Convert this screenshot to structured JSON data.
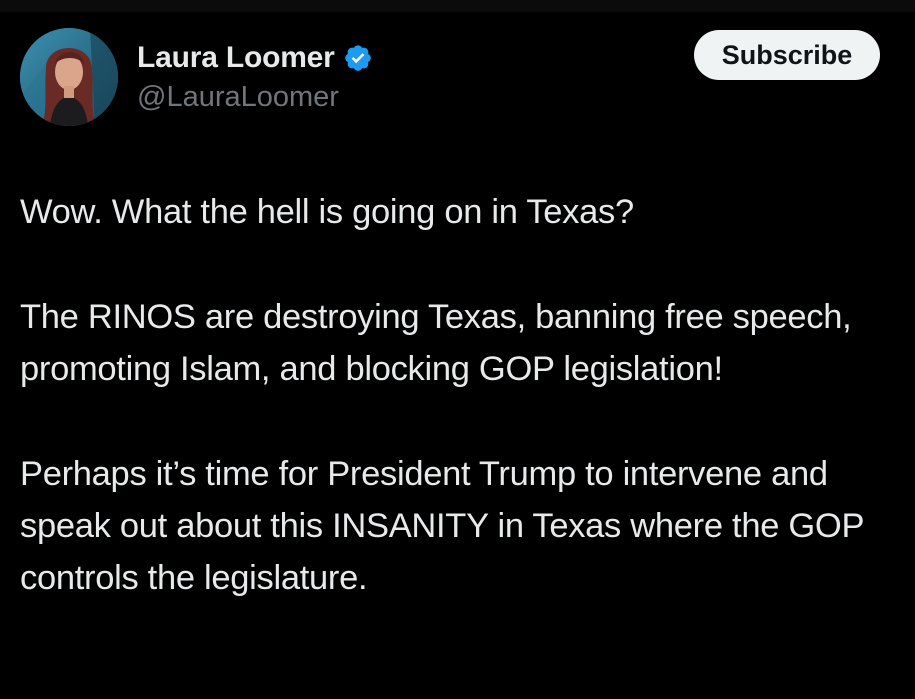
{
  "author": {
    "display_name": "Laura Loomer",
    "handle": "@LauraLoomer",
    "verified_icon": "verified-badge-icon",
    "verified_color": "#1d9bf0"
  },
  "actions": {
    "subscribe_label": "Subscribe"
  },
  "tweet": {
    "paragraphs": [
      "Wow. What the hell is going on in Texas?",
      "The RINOS are destroying Texas, banning free speech, promoting Islam, and blocking GOP legislation!",
      "Perhaps it’s time for President Trump to intervene and speak out about this INSANITY in Texas where the GOP controls the legislature."
    ]
  },
  "colors": {
    "background": "#000000",
    "text_primary": "#e7e9ea",
    "text_secondary": "#71767b",
    "button_bg": "#eff3f4"
  }
}
